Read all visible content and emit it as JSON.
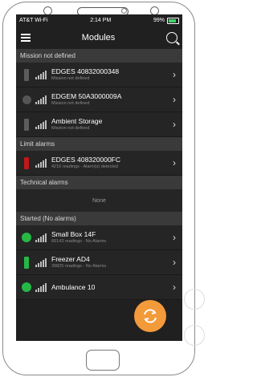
{
  "status_bar": {
    "carrier": "AT&T Wi-Fi",
    "time": "2:14 PM",
    "battery": "99%"
  },
  "app_bar": {
    "title": "Modules",
    "menu_icon": "hamburger-icon",
    "search_icon": "search-icon"
  },
  "sections": [
    {
      "title": "Mission not defined"
    },
    {
      "title": "Limit alarms"
    },
    {
      "title": "Technical alarms",
      "empty_text": "None"
    },
    {
      "title": "Started (No alarms)"
    }
  ],
  "modules": [
    {
      "name": "EDGES 40832000348",
      "subtitle": "Mission not defined",
      "status": "grey-bar"
    },
    {
      "name": "EDGEM 50A3000009A",
      "subtitle": "Mission not defined",
      "status": "grey-circle"
    },
    {
      "name": "Ambient Storage",
      "subtitle": "Mission not defined",
      "status": "grey-bar"
    },
    {
      "name": "EDGES 408320000FC",
      "subtitle": "4216 readings - Alarm(s) detected",
      "status": "red-bar"
    },
    {
      "name": "Small Box 14F",
      "subtitle": "66143 readings - No Alarms",
      "status": "green-circle"
    },
    {
      "name": "Freezer AD4",
      "subtitle": "39825 readings - No Alarms",
      "status": "green-bar"
    },
    {
      "name": "Ambulance 10",
      "subtitle": "",
      "status": "green-circle"
    }
  ],
  "fab_icon": "refresh-icon",
  "colors": {
    "accent": "#f39a3a",
    "ok": "#25b847",
    "alarm": "#c01818",
    "background": "#202020"
  }
}
